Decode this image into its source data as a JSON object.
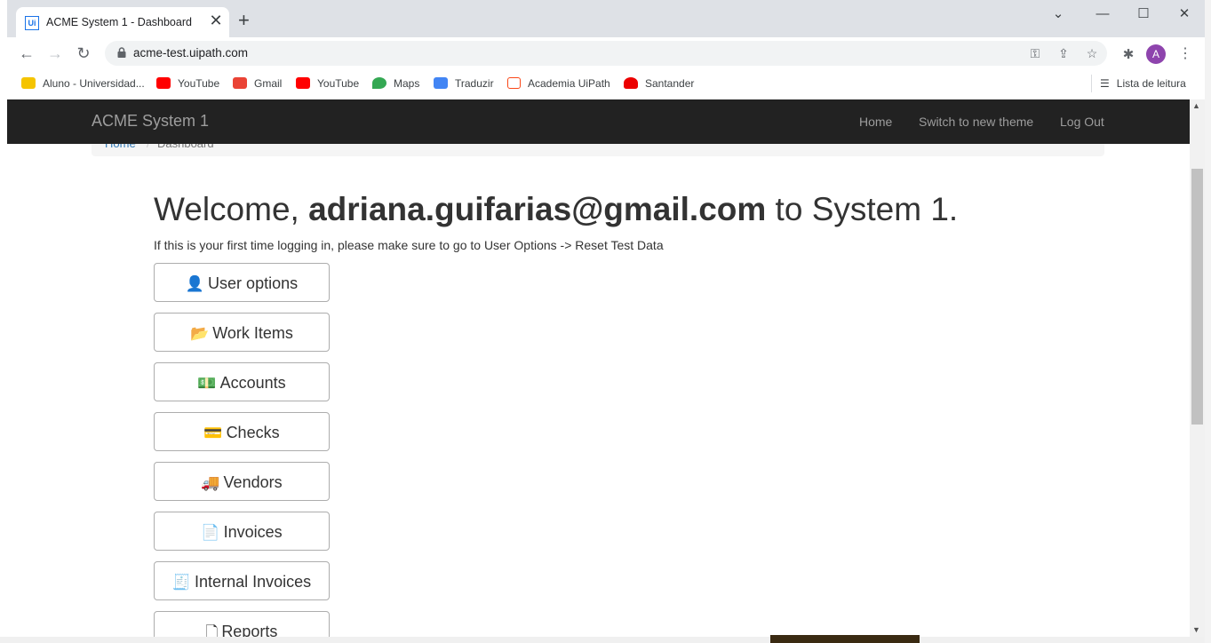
{
  "browser": {
    "tab_title": "ACME System 1 - Dashboard",
    "tab_favicon": "Ui",
    "tab_close": "✕",
    "new_tab": "+",
    "url": "acme-test.uipath.com",
    "avatar_letter": "A",
    "bookmarks": [
      {
        "label": "Aluno - Universidad...",
        "icon": "university-icon",
        "color": "#f5c400"
      },
      {
        "label": "YouTube",
        "icon": "youtube-icon",
        "color": "#ff0000"
      },
      {
        "label": "Gmail",
        "icon": "gmail-icon",
        "color": "#ea4335"
      },
      {
        "label": "YouTube",
        "icon": "youtube-icon",
        "color": "#ff0000"
      },
      {
        "label": "Maps",
        "icon": "maps-icon",
        "color": "#34a853"
      },
      {
        "label": "Traduzir",
        "icon": "translate-icon",
        "color": "#4285f4"
      },
      {
        "label": "Academia UiPath",
        "icon": "uipath-icon",
        "color": "#fa4616"
      },
      {
        "label": "Santander",
        "icon": "santander-icon",
        "color": "#ec0000"
      }
    ],
    "reading_list": "Lista de leitura"
  },
  "app": {
    "brand": "ACME System 1",
    "nav": {
      "home": "Home",
      "switch_theme": "Switch to new theme",
      "logout": "Log Out"
    },
    "breadcrumb": {
      "home": "Home",
      "separator": "/",
      "current": "Dashboard"
    },
    "welcome": {
      "prefix": "Welcome, ",
      "user": "adriana.guifarias@gmail.com",
      "suffix": " to System 1."
    },
    "hint": "If this is your first time logging in, please make sure to go to User Options -> Reset Test Data",
    "menu": [
      {
        "label": "User options",
        "icon": "user-icon"
      },
      {
        "label": "Work Items",
        "icon": "folder-open-icon"
      },
      {
        "label": "Accounts",
        "icon": "money-icon"
      },
      {
        "label": "Checks",
        "icon": "credit-card-icon"
      },
      {
        "label": "Vendors",
        "icon": "truck-icon"
      },
      {
        "label": "Invoices",
        "icon": "file-text-icon"
      },
      {
        "label": "Internal Invoices",
        "icon": "file-dollar-icon"
      },
      {
        "label": "Reports",
        "icon": "file-icon"
      }
    ]
  },
  "colors": {
    "navbar_bg": "#222222",
    "navbar_text": "#9d9d9d",
    "link": "#337ab7",
    "text": "#333333"
  }
}
